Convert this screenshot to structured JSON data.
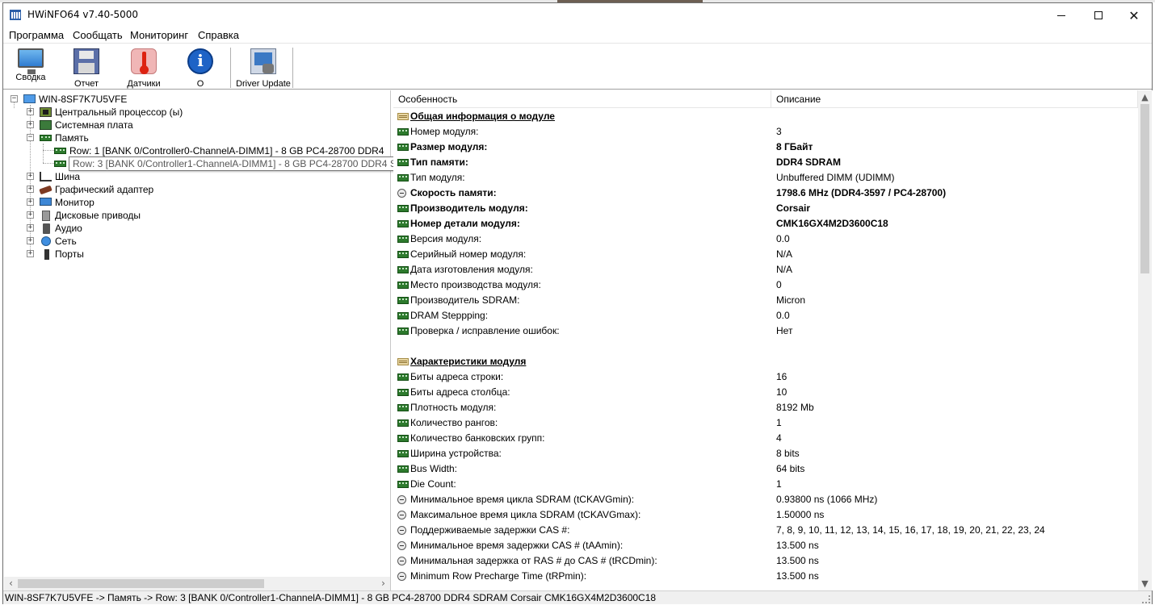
{
  "window": {
    "title": "HWiNFO64 v7.40-5000"
  },
  "menu": [
    "Программа",
    "Сообщать",
    "Мониторинг",
    "Справка"
  ],
  "toolbar": {
    "summary": "Сводка",
    "report": "Отчет",
    "sensors": "Датчики",
    "about": "О",
    "driver_update": "Driver Update"
  },
  "tree": {
    "root": "WIN-8SF7K7U5VFE",
    "cpu": "Центральный процессор (ы)",
    "board": "Системная плата",
    "memory": "Память",
    "row1": "Row: 1 [BANK 0/Controller0-ChannelA-DIMM1] - 8 GB PC4-28700 DDR4",
    "row3": "Row: 3 [BANK 0/Controller1-ChannelA-DIMM1] - 8 GB PC4-28700 DDR4 SDRAM Corsair CMK16GX4M2D3600C18",
    "bus": "Шина",
    "gpu": "Графический адаптер",
    "monitor": "Монитор",
    "drives": "Дисковые приводы",
    "audio": "Аудио",
    "network": "Сеть",
    "ports": "Порты",
    "tooltip": "Row: 3 [BANK 0/Controller1-ChannelA-DIMM1] - 8 GB PC4-28700 DDR4 SDRAM Corsair CMK16GX4M2D3600C18"
  },
  "details": {
    "col_feature": "Особенность",
    "col_description": "Описание",
    "rows": [
      {
        "type": "section",
        "icon": "section",
        "feature": "Общая информация о модуле",
        "value": ""
      },
      {
        "type": "normal",
        "icon": "ram",
        "feature": "Номер модуля:",
        "value": "3"
      },
      {
        "type": "bold",
        "icon": "ram",
        "feature": "Размер модуля:",
        "value": "8 ГБайт"
      },
      {
        "type": "bold",
        "icon": "ram",
        "feature": "Тип памяти:",
        "value": "DDR4 SDRAM"
      },
      {
        "type": "normal",
        "icon": "ram",
        "feature": "Тип модуля:",
        "value": "Unbuffered DIMM (UDIMM)"
      },
      {
        "type": "bold",
        "icon": "clock",
        "feature": "Скорость памяти:",
        "value": "1798.6 MHz (DDR4-3597 / PC4-28700)"
      },
      {
        "type": "bold",
        "icon": "ram",
        "feature": "Производитель модуля:",
        "value": "Corsair"
      },
      {
        "type": "bold",
        "icon": "ram",
        "feature": "Номер детали модуля:",
        "value": "CMK16GX4M2D3600C18"
      },
      {
        "type": "normal",
        "icon": "ram",
        "feature": "Версия модуля:",
        "value": "0.0"
      },
      {
        "type": "normal",
        "icon": "ram",
        "feature": "Серийный номер модуля:",
        "value": "N/A"
      },
      {
        "type": "normal",
        "icon": "ram",
        "feature": "Дата изготовления модуля:",
        "value": "N/A"
      },
      {
        "type": "normal",
        "icon": "ram",
        "feature": "Место производства модуля:",
        "value": "0"
      },
      {
        "type": "normal",
        "icon": "ram",
        "feature": "Производитель SDRAM:",
        "value": "Micron"
      },
      {
        "type": "normal",
        "icon": "ram",
        "feature": "DRAM Steppping:",
        "value": "0.0"
      },
      {
        "type": "normal",
        "icon": "ram",
        "feature": "Проверка / исправление ошибок:",
        "value": "Нет"
      },
      {
        "type": "blank",
        "icon": "",
        "feature": "",
        "value": ""
      },
      {
        "type": "section",
        "icon": "section",
        "feature": "Характеристики модуля",
        "value": ""
      },
      {
        "type": "normal",
        "icon": "ram",
        "feature": "Биты адреса строки:",
        "value": "16"
      },
      {
        "type": "normal",
        "icon": "ram",
        "feature": "Биты адреса столбца:",
        "value": "10"
      },
      {
        "type": "normal",
        "icon": "ram",
        "feature": "Плотность модуля:",
        "value": "8192 Mb"
      },
      {
        "type": "normal",
        "icon": "ram",
        "feature": "Количество рангов:",
        "value": "1"
      },
      {
        "type": "normal",
        "icon": "ram",
        "feature": "Количество банковских групп:",
        "value": "4"
      },
      {
        "type": "normal",
        "icon": "ram",
        "feature": "Ширина устройства:",
        "value": "8 bits"
      },
      {
        "type": "normal",
        "icon": "ram",
        "feature": "Bus Width:",
        "value": "64 bits"
      },
      {
        "type": "normal",
        "icon": "ram",
        "feature": "Die Count:",
        "value": "1"
      },
      {
        "type": "normal",
        "icon": "clock",
        "feature": "Минимальное время цикла SDRAM (tCKAVGmin):",
        "value": "0.93800 ns (1066 MHz)"
      },
      {
        "type": "normal",
        "icon": "clock",
        "feature": "Максимальное время цикла SDRAM (tCKAVGmax):",
        "value": "1.50000 ns"
      },
      {
        "type": "normal",
        "icon": "clock",
        "feature": "Поддерживаемые задержки CAS #:",
        "value": "7, 8, 9, 10, 11, 12, 13, 14, 15, 16, 17, 18, 19, 20, 21, 22, 23, 24"
      },
      {
        "type": "normal",
        "icon": "clock",
        "feature": "Минимальное время задержки CAS # (tAAmin):",
        "value": "13.500 ns"
      },
      {
        "type": "normal",
        "icon": "clock",
        "feature": "Минимальная задержка от RAS # до CAS # (tRCDmin):",
        "value": "13.500 ns"
      },
      {
        "type": "normal",
        "icon": "clock",
        "feature": "Minimum Row Precharge Time (tRPmin):",
        "value": "13.500 ns"
      }
    ]
  },
  "status": "WIN-8SF7K7U5VFE -> Память -> Row: 3 [BANK 0/Controller1-ChannelA-DIMM1] - 8 GB PC4-28700 DDR4 SDRAM Corsair CMK16GX4M2D3600C18"
}
